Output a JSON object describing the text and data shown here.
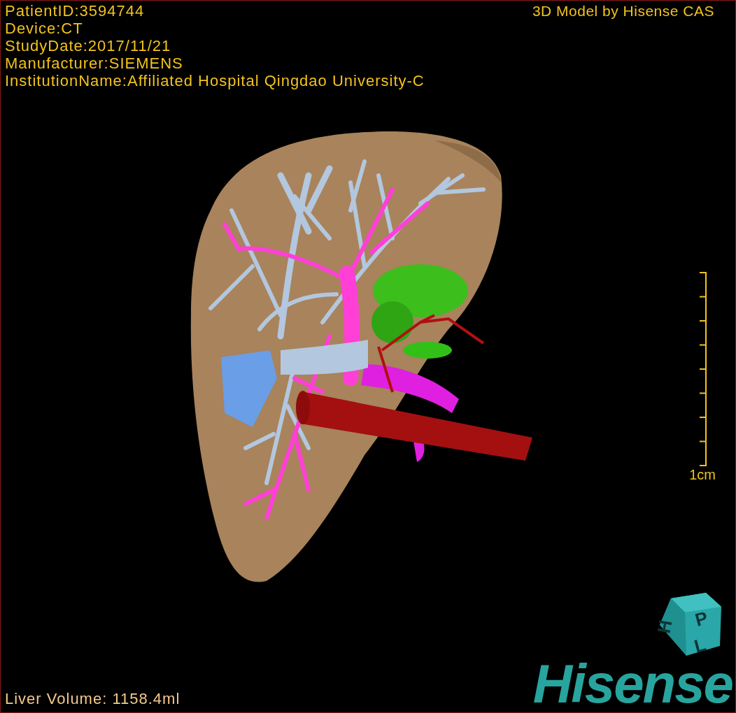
{
  "overlay": {
    "info_lines": [
      "PatientID:3594744",
      "Device:CT",
      "StudyDate:2017/11/21",
      "Manufacturer:SIEMENS",
      "InstitutionName:Affiliated Hospital Qingdao University-C"
    ],
    "title": "3D Model by Hisense CAS"
  },
  "scale_bar": {
    "label": "1cm"
  },
  "orientation_cube": {
    "faces": [
      "H",
      "P",
      "L"
    ]
  },
  "measurement": "Liver Volume: 1158.4ml",
  "logo": "Hisense"
}
